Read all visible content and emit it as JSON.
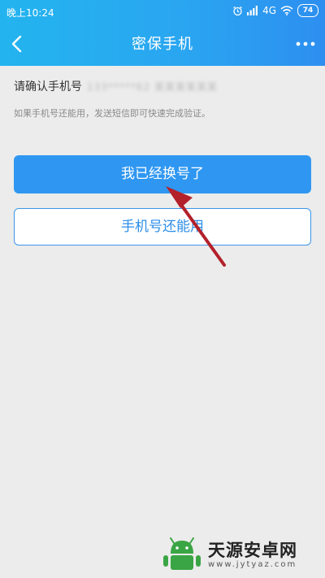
{
  "status_bar": {
    "time": "晚上10:24",
    "network": "4G",
    "battery": "74"
  },
  "header": {
    "title": "密保手机"
  },
  "main": {
    "confirm_label": "请确认手机号",
    "masked_number": "133*****62 某某某某某某",
    "hint": "如果手机号还能用，发送短信即可快速完成验证。"
  },
  "buttons": {
    "changed_number": "我已经换号了",
    "still_usable": "手机号还能用"
  },
  "watermark": {
    "name": "天源安卓网",
    "url": "www.jytyaz.com"
  },
  "colors": {
    "header_start": "#23b4ef",
    "header_end": "#2d8ff0",
    "primary_button": "#2f97f1",
    "annotation_arrow": "#b3212a",
    "logo_green": "#3aa544"
  }
}
